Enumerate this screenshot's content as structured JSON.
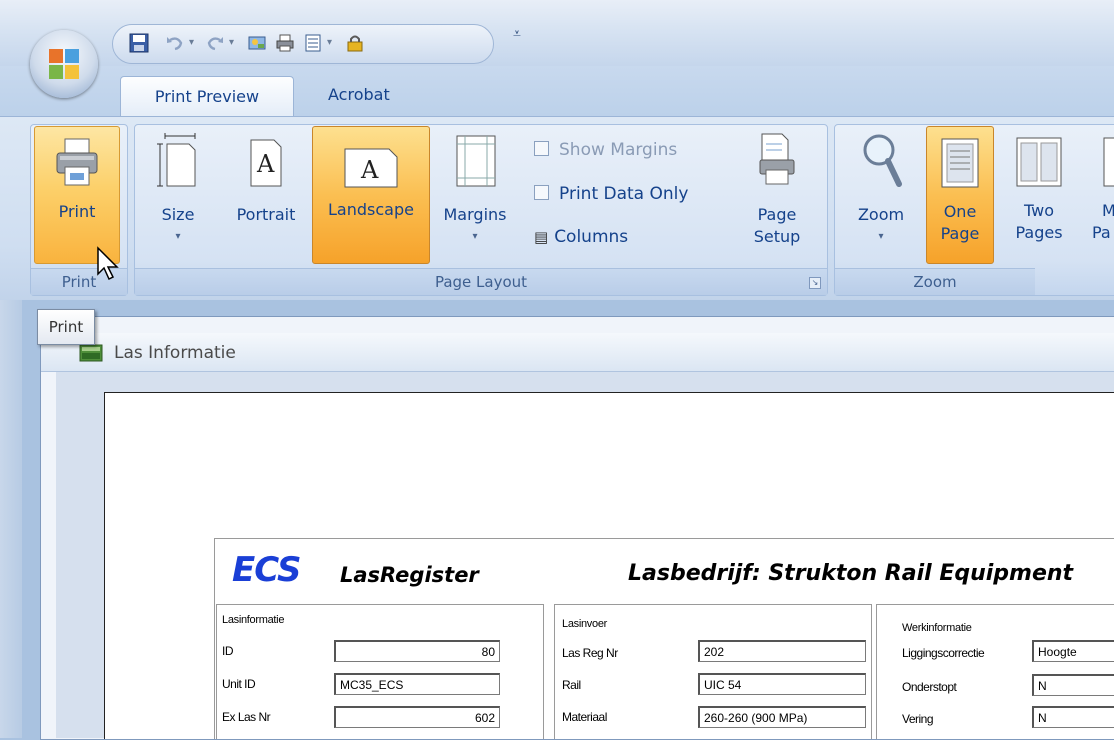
{
  "tabs": [
    {
      "label": "Print Preview",
      "active": true
    },
    {
      "label": "Acrobat",
      "active": false
    }
  ],
  "groups": {
    "print": {
      "label": "Print",
      "print_button": "Print"
    },
    "page_layout": {
      "label": "Page Layout",
      "size": "Size",
      "portrait": "Portrait",
      "landscape": "Landscape",
      "margins": "Margins",
      "show_margins": "Show Margins",
      "print_data_only": "Print Data Only",
      "columns": "Columns",
      "page_setup_1": "Page",
      "page_setup_2": "Setup"
    },
    "zoom": {
      "label": "Zoom",
      "zoom": "Zoom",
      "one_page_1": "One",
      "one_page_2": "Page",
      "two_pages_1": "Two",
      "two_pages_2": "Pages",
      "more_pages_1": "M",
      "more_pages_2": "Pa"
    }
  },
  "tooltip": "Print",
  "document": {
    "title": "Las Informatie"
  },
  "report": {
    "logo": "ECS",
    "title": "LasRegister",
    "company": "Lasbedrijf: Strukton Rail Equipment",
    "panels": [
      {
        "title": "Lasinformatie",
        "fields": [
          {
            "label": "ID",
            "value": "80"
          },
          {
            "label": "Unit ID",
            "value": "MC35_ECS"
          },
          {
            "label": "Ex Las Nr",
            "value": "602"
          }
        ]
      },
      {
        "title": "Lasinvoer",
        "fields": [
          {
            "label": "Las Reg Nr",
            "value": "202"
          },
          {
            "label": "Rail",
            "value": "UIC 54"
          },
          {
            "label": "Materiaal",
            "value": "260-260 (900 MPa)"
          }
        ]
      },
      {
        "title": "Werkinformatie",
        "fields": [
          {
            "label": "Liggingscorrectie",
            "value": "Hoogte"
          },
          {
            "label": "Onderstopt",
            "value": "N"
          },
          {
            "label": "Vering",
            "value": "N"
          }
        ]
      }
    ]
  },
  "colors": {
    "ribbon_text": "#15428b",
    "highlight": "#f9b33e",
    "logo_blue": "#1a3fd6"
  }
}
